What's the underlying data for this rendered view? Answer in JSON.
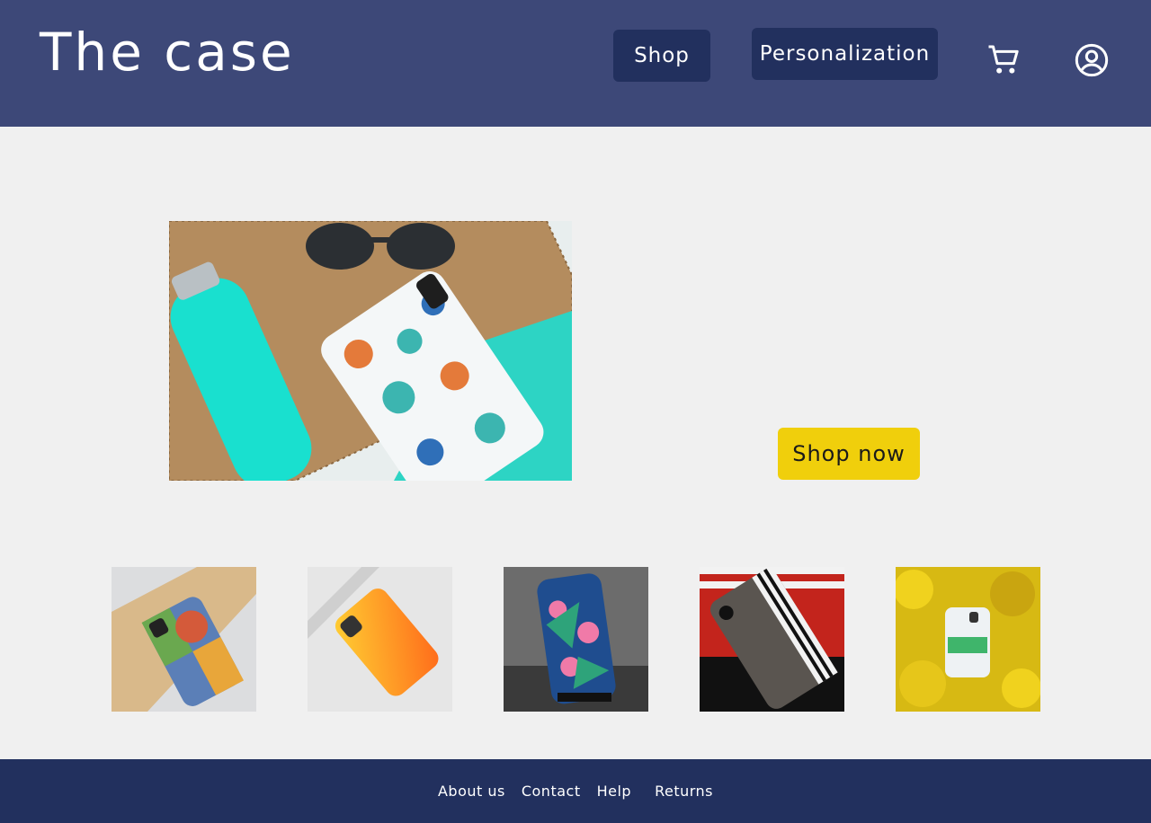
{
  "header": {
    "brand": "The case",
    "nav": {
      "shop": "Shop",
      "personalization": "Personalization"
    },
    "icons": {
      "cart": "cart-icon",
      "account": "account-icon"
    },
    "bg_color": "#3d4878",
    "button_color": "#22305e"
  },
  "hero": {
    "image": "phone-case-cactus-photo",
    "cta_label": "Shop now",
    "cta_color": "#f0cf0c"
  },
  "products": [
    {
      "image": "geometric-case-photo"
    },
    {
      "image": "orange-gradient-case-photo"
    },
    {
      "image": "floral-blue-case-photo"
    },
    {
      "image": "marble-stripe-case-photo"
    },
    {
      "image": "ask-more-case-photo"
    }
  ],
  "footer": {
    "links": [
      "About us",
      "Contact",
      "Help",
      "Returns"
    ],
    "bg_color": "#22305e"
  }
}
